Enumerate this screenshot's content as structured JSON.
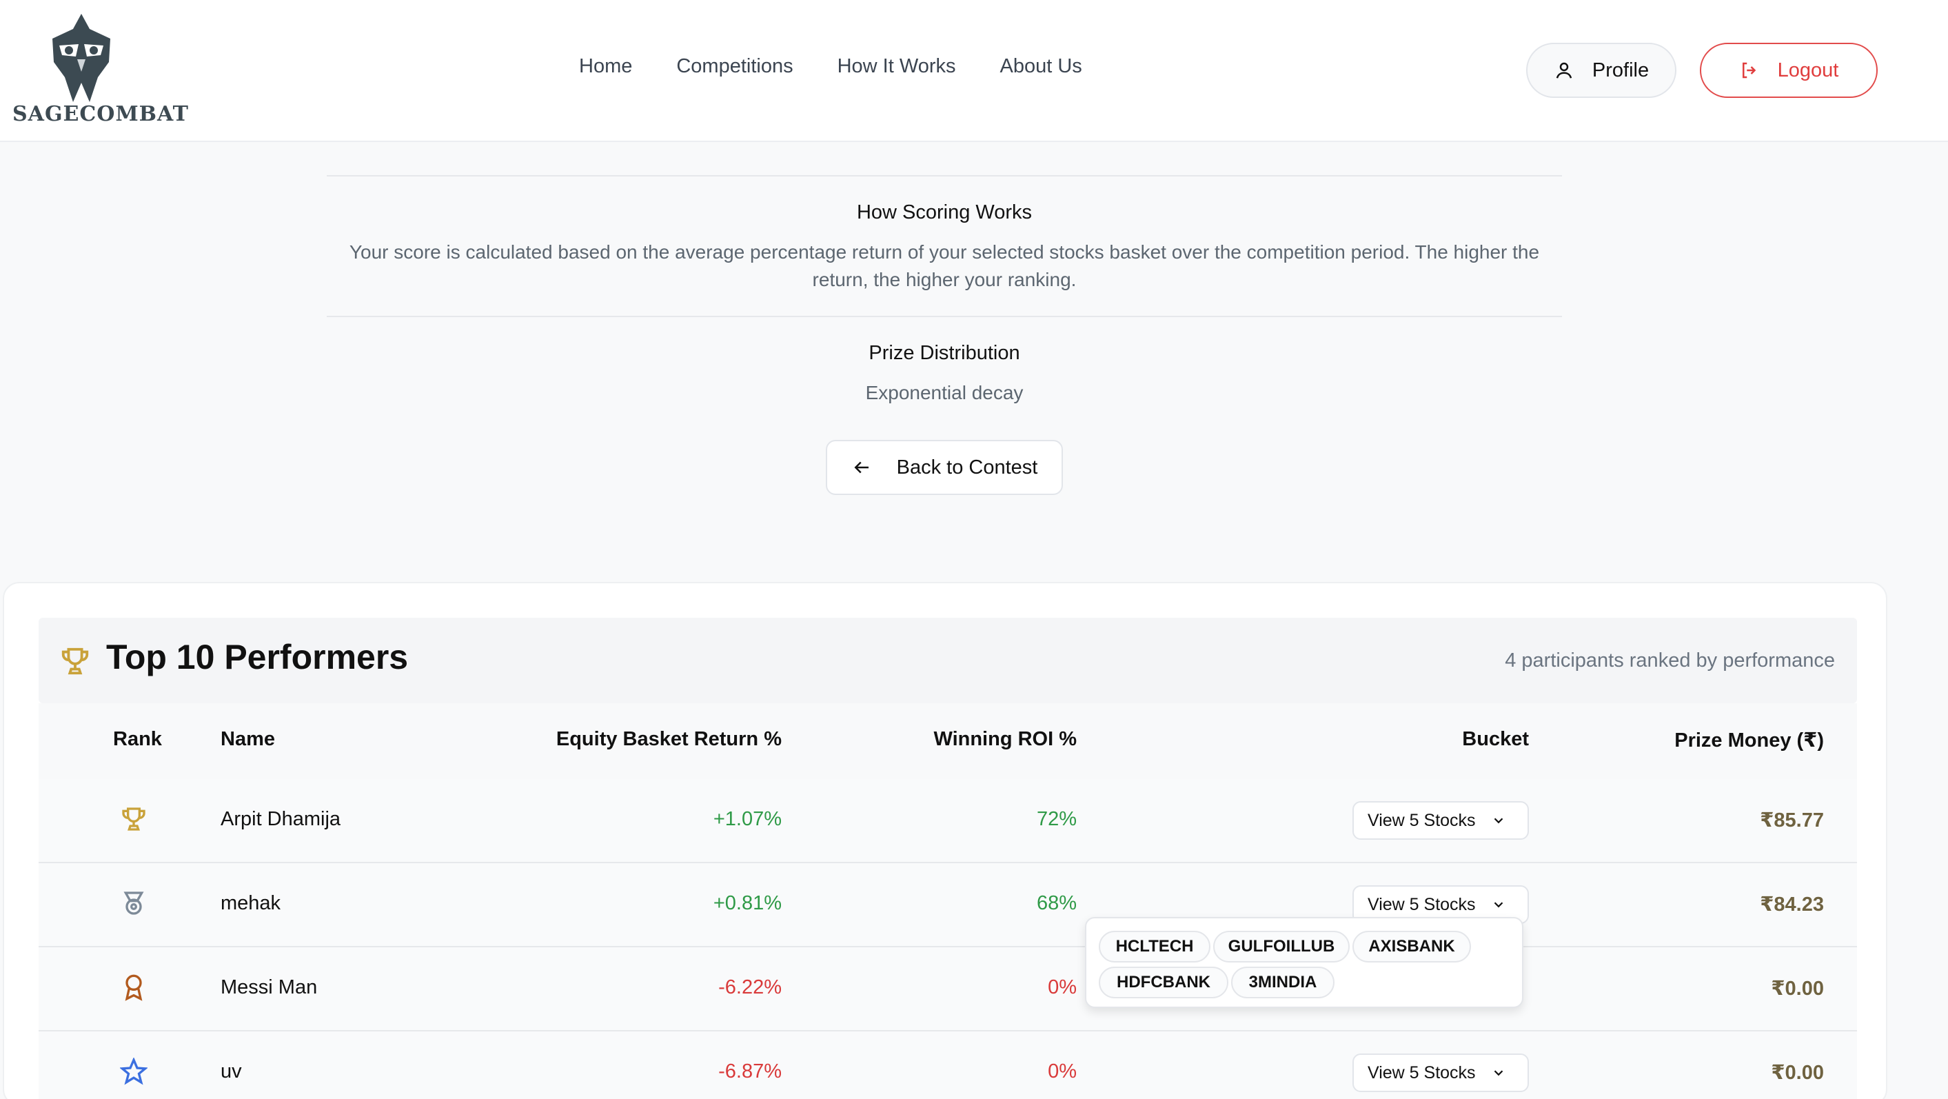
{
  "header": {
    "logo_text": "SAGECOMBAT",
    "nav": [
      "Home",
      "Competitions",
      "How It Works",
      "About Us"
    ],
    "profile_label": "Profile",
    "logout_label": "Logout"
  },
  "info": {
    "scoring_title": "How Scoring Works",
    "scoring_text": "Your score is calculated based on the average percentage return of your selected stocks basket over the competition period. The higher the return, the higher your ranking.",
    "prize_title": "Prize Distribution",
    "prize_text": "Exponential decay",
    "back_label": "Back to Contest"
  },
  "leaderboard": {
    "title": "Top 10 Performers",
    "subtitle": "4 participants ranked by performance",
    "columns": [
      "Rank",
      "Name",
      "Equity Basket Return %",
      "Winning ROI %",
      "Bucket",
      "Prize Money (₹)"
    ],
    "rows": [
      {
        "rank_icon": "trophy-icon",
        "name": "Arpit Dhamija",
        "equity_return": "+1.07%",
        "roi": "72%",
        "bucket": "View 5 Stocks",
        "prize": "₹85.77"
      },
      {
        "rank_icon": "medal-icon",
        "name": "mehak",
        "equity_return": "+0.81%",
        "roi": "68%",
        "bucket": "View 5 Stocks",
        "prize": "₹84.23"
      },
      {
        "rank_icon": "award-icon",
        "name": "Messi Man",
        "equity_return": "-6.22%",
        "roi": "0%",
        "bucket": "",
        "prize": "₹0.00"
      },
      {
        "rank_icon": "star-icon",
        "name": "uv",
        "equity_return": "-6.87%",
        "roi": "0%",
        "bucket": "View 5 Stocks",
        "prize": "₹0.00"
      }
    ],
    "popover_stocks": [
      "HCLTECH",
      "GULFOILLUB",
      "AXISBANK",
      "HDFCBANK",
      "3MINDIA"
    ]
  },
  "colors": {
    "positive": "#2f9a47",
    "negative": "#d93a3a",
    "logout_red": "#e03d3d",
    "gold": "#c9a23a"
  }
}
